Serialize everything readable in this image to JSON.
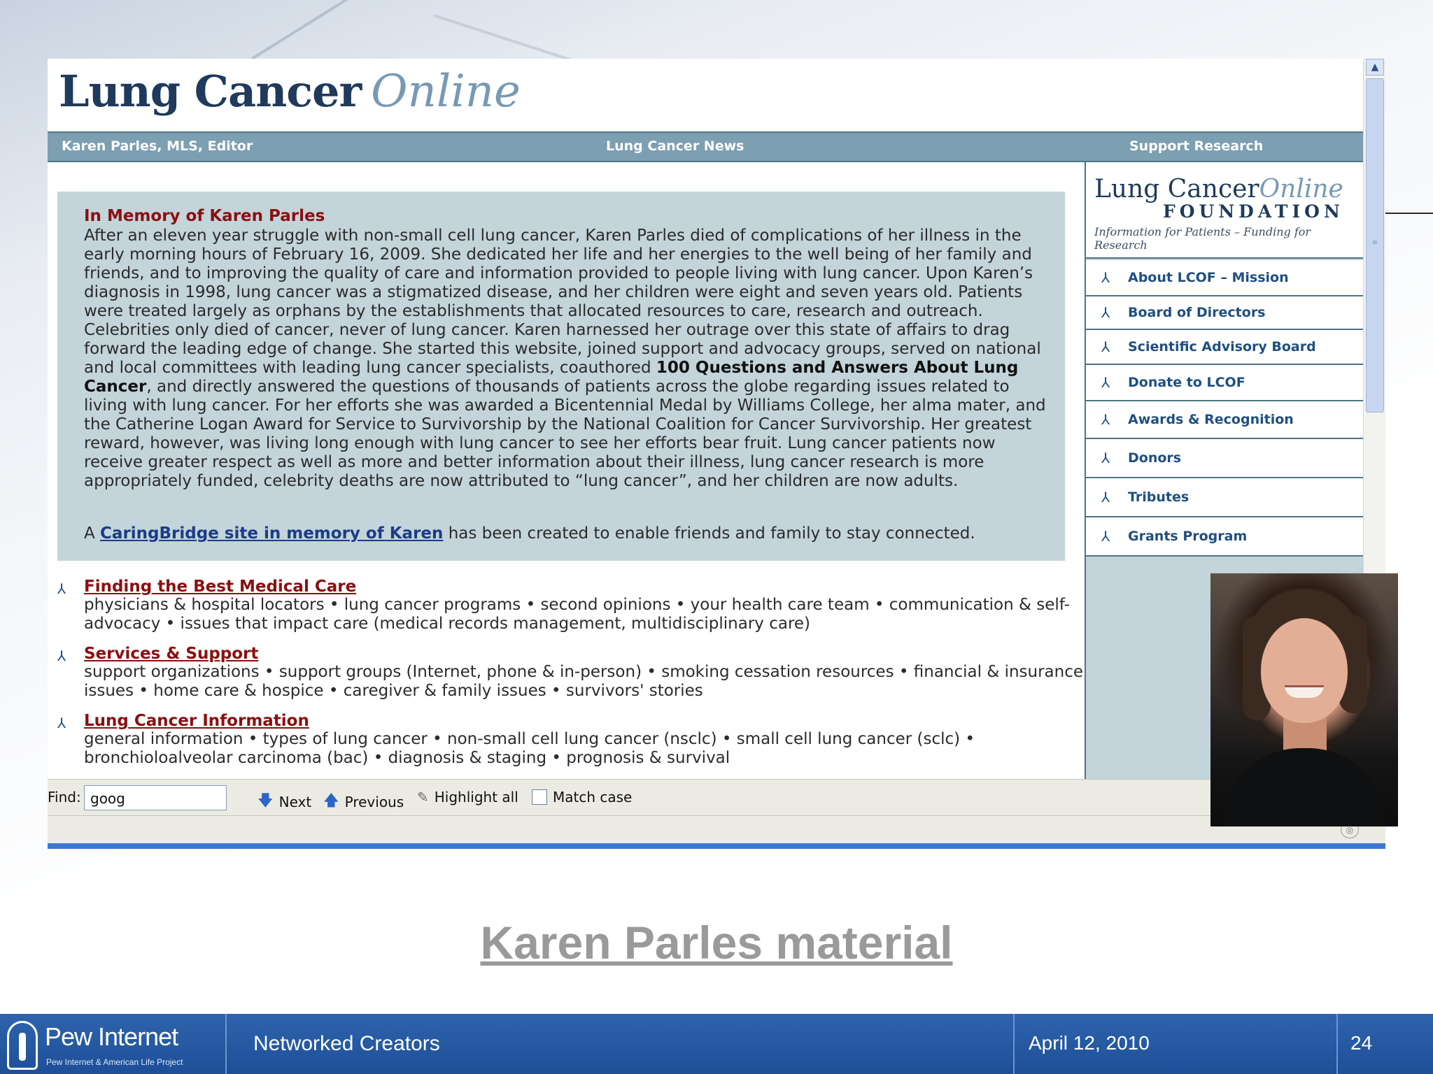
{
  "site": {
    "logo_main": "Lung Cancer",
    "logo_accent": "Online",
    "nav": [
      "Karen Parles, MLS, Editor",
      "Lung Cancer News",
      "Support Research"
    ]
  },
  "memorial": {
    "heading": "In Memory of Karen Parles",
    "body_before_bold": "After an eleven year struggle with non-small cell lung cancer, Karen Parles died of complications of her illness in the early morning hours of February 16, 2009.  She dedicated her life and her energies to the well being of her family and friends, and to improving the quality of care and information provided to people living with lung cancer.  Upon Karen’s diagnosis in 1998, lung cancer was a stigmatized disease, and her children were eight and seven years old.  Patients were treated largely as orphans by the establishments that allocated resources to care, research and outreach.  Celebrities only died of cancer, never of lung cancer.  Karen harnessed her outrage over this state of affairs to drag forward the leading edge of change.  She started this website, joined support and advocacy groups, served on national and local committees with leading lung cancer specialists, coauthored ",
    "body_bold": "100 Questions and Answers About Lung Cancer",
    "body_after_bold": ", and directly answered the questions of thousands of patients across the globe regarding issues related to living with lung cancer.  For her efforts she was awarded a Bicentennial Medal by Williams College, her alma mater, and the Catherine Logan Award for Service to Survivorship by the National Coalition for Cancer Survivorship.  Her greatest reward, however, was living long enough with lung cancer to see her efforts bear fruit.  Lung cancer patients now receive greater respect as well as more and better information about their illness, lung cancer research is more appropriately funded, celebrity deaths are now attributed to “lung cancer”, and her children are now adults.",
    "link_prefix": "A",
    "link_text": "CaringBridge site in memory of Karen",
    "link_suffix": "has been created to enable friends and family to stay connected."
  },
  "sections": [
    {
      "title": "Finding the Best Medical Care",
      "desc": "physicians & hospital locators • lung cancer programs • second opinions • your health care team • communication & self-advocacy • issues that impact care (medical records management, multidisciplinary care)"
    },
    {
      "title": "Services & Support",
      "desc": "support organizations • support groups (Internet, phone & in-person) • smoking cessation resources • financial & insurance issues • home care & hospice • caregiver & family issues • survivors' stories"
    },
    {
      "title": "Lung Cancer Information",
      "desc": "general information • types of lung cancer • non-small cell lung cancer (nsclc) • small cell lung cancer (sclc) • bronchioloalveolar carcinoma (bac) • diagnosis & staging • prognosis & survival"
    }
  ],
  "foundation": {
    "logo_main": "Lung Cancer",
    "logo_accent": "Online",
    "logo_sub": "FOUNDATION",
    "tagline": "Information for Patients – Funding for Research",
    "menu": [
      "About LCOF – Mission",
      "Board of Directors",
      "Scientific Advisory Board",
      "Donate to LCOF",
      "Awards & Recognition",
      "Donors",
      "Tributes",
      "Grants Program"
    ]
  },
  "findbar": {
    "label": "Find:",
    "value": "goog",
    "next": "Next",
    "previous": "Previous",
    "highlight": "Highlight all",
    "match": "Match case"
  },
  "slide": {
    "caption": "Karen Parles material",
    "brand": "Pew Internet",
    "brand_sub": "Pew Internet & American Life Project",
    "topic": "Networked Creators",
    "date": "April 12, 2010",
    "page": "24"
  },
  "icons": {
    "bullet": "arrow-bullet-icon",
    "next": "down-arrow-icon",
    "previous": "up-arrow-icon",
    "highlight": "highlighter-icon"
  },
  "colors": {
    "nav_bar": "#7c9fb1",
    "memorial_bg": "#c3d4da",
    "heading_red": "#8a1010",
    "link_blue": "#1a3c8a",
    "footer_blue": "#2e64ad"
  }
}
